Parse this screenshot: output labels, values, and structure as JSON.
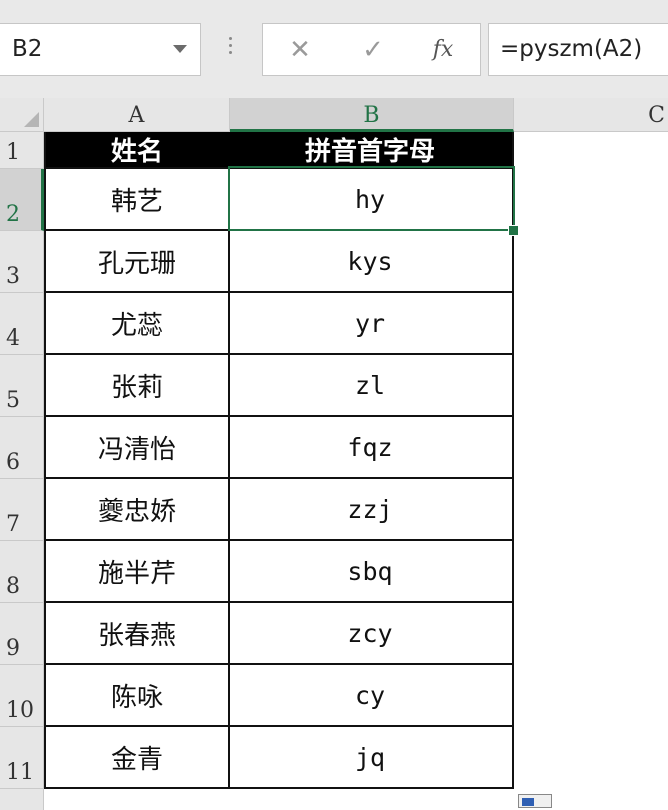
{
  "formula_bar": {
    "name_box": "B2",
    "formula": "=pyszm(A2)",
    "cancel_glyph": "✕",
    "enter_glyph": "✓",
    "fx_label": "fx"
  },
  "columns": [
    "A",
    "B",
    "C"
  ],
  "rows": [
    "1",
    "2",
    "3",
    "4",
    "5",
    "6",
    "7",
    "8",
    "9",
    "10",
    "11"
  ],
  "header": {
    "name": "姓名",
    "pinyin": "拼音首字母"
  },
  "data": [
    {
      "name": "韩艺",
      "pinyin": "hy"
    },
    {
      "name": "孔元珊",
      "pinyin": "kys"
    },
    {
      "name": "尤蕊",
      "pinyin": "yr"
    },
    {
      "name": "张莉",
      "pinyin": "zl"
    },
    {
      "name": "冯清怡",
      "pinyin": "fqz"
    },
    {
      "name": "夔忠娇",
      "pinyin": "zzj"
    },
    {
      "name": "施半芹",
      "pinyin": "sbq"
    },
    {
      "name": "张春燕",
      "pinyin": "zcy"
    },
    {
      "name": "陈咏",
      "pinyin": "cy"
    },
    {
      "name": "金青",
      "pinyin": "jq"
    }
  ],
  "colors": {
    "accent": "#217346",
    "header_bg": "#000000",
    "header_text": "#ffffff"
  }
}
